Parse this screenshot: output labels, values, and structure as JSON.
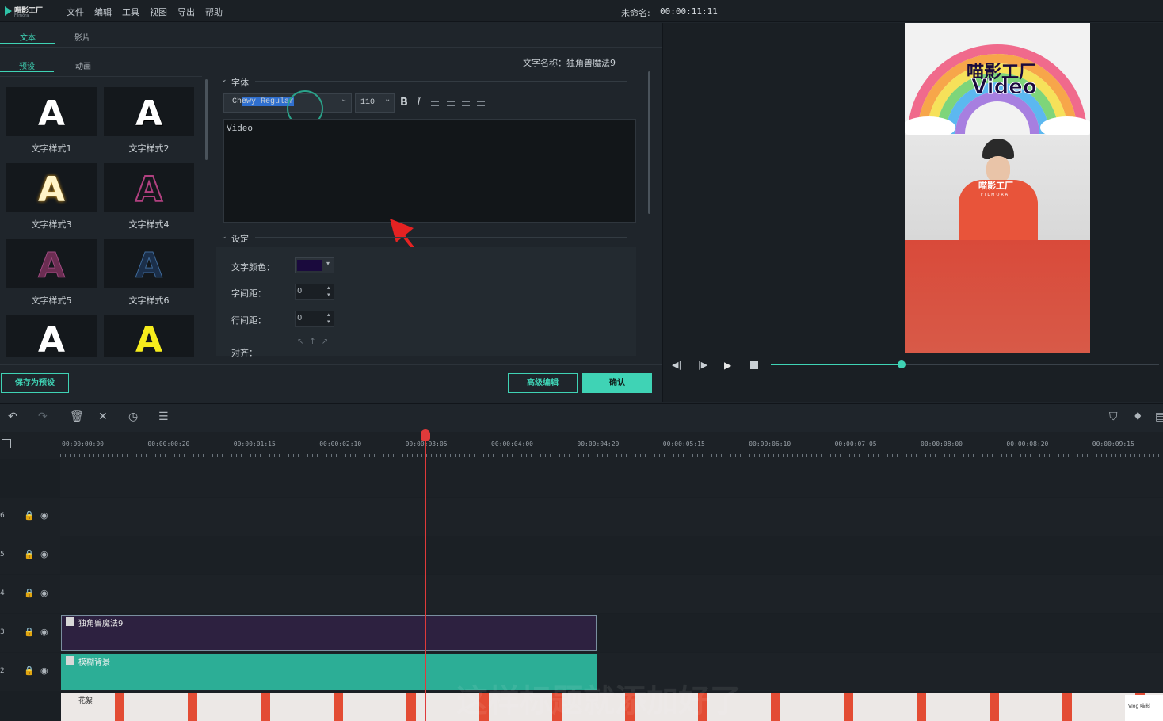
{
  "app": {
    "logo_text": "喵影工厂",
    "logo_sub": "Filmora",
    "menu": [
      "文件",
      "编辑",
      "工具",
      "视图",
      "导出",
      "帮助"
    ],
    "project_title": "未命名:",
    "project_time": "00:00:11:11"
  },
  "editor": {
    "tabs": [
      "文本",
      "影片"
    ],
    "subtabs": [
      "预设",
      "动画"
    ],
    "presets": [
      {
        "label": "文字样式1",
        "color": "#ffffff"
      },
      {
        "label": "文字样式2",
        "color": "#ffffff"
      },
      {
        "label": "文字样式3",
        "color": "#fff4c8"
      },
      {
        "label": "文字样式4",
        "color": "#6a2a5e"
      },
      {
        "label": "文字样式5",
        "color": "#6b2d52"
      },
      {
        "label": "文字样式6",
        "color": "#1b2f4a"
      },
      {
        "label": "",
        "color": "#ffffff"
      },
      {
        "label": "",
        "color": "#f6ec1c"
      }
    ],
    "preset_glyph": "A",
    "text_name_label": "文字名称：独角兽魔法9",
    "font_section": "字体",
    "font_name": "Chewy Regular",
    "font_size": "110",
    "bold_label": "B",
    "italic_label": "I",
    "text_content": "Video",
    "settings_section": "设定",
    "settings": {
      "color_label": "文字颜色：",
      "color_value": "#1a0a3d",
      "spacing_label": "字间距：",
      "spacing_value": "0",
      "line_spacing_label": "行间距：",
      "line_spacing_value": "0",
      "align_label": "对齐："
    },
    "save_preset_button": "保存为预设",
    "advanced_edit_button": "高级编辑",
    "confirm_button": "确认"
  },
  "preview": {
    "overlay_brand": "喵影工厂",
    "overlay_video": "Video",
    "hat_text": "喵影工厂",
    "hat_sub": "FILMORA"
  },
  "timeline": {
    "ticks": [
      "00:00:00:00",
      "00:00:00:20",
      "00:00:01:15",
      "00:00:02:10",
      "00:00:03:05",
      "00:00:04:00",
      "00:00:04:20",
      "00:00:05:15",
      "00:00:06:10",
      "00:00:07:05",
      "00:00:08:00",
      "00:00:08:20",
      "00:00:09:15"
    ],
    "tracks": [
      "6",
      "5",
      "4",
      "3",
      "2"
    ],
    "clip_title": "独角兽魔法9",
    "clip_bg": "模糊背景",
    "clip_video_label": "花絮",
    "clip_end_label": "Vlog 喵影",
    "subtitle_overlay": "这样标题就添加好了"
  }
}
